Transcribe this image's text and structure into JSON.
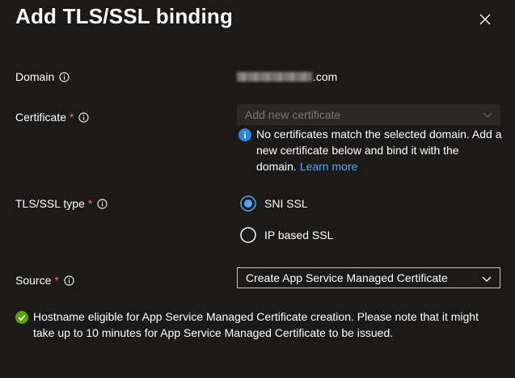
{
  "dialog": {
    "title": "Add TLS/SSL binding"
  },
  "domain": {
    "label": "Domain",
    "value_suffix": ".com"
  },
  "certificate": {
    "label": "Certificate",
    "required_mark": "*",
    "placeholder": "Add new certificate",
    "notice_text": "No certificates match the selected domain. Add a new certificate below and bind it with the domain.",
    "learn_more": "Learn more"
  },
  "tls_type": {
    "label": "TLS/SSL type",
    "required_mark": "*",
    "options": [
      {
        "label": "SNI SSL",
        "selected": true
      },
      {
        "label": "IP based SSL",
        "selected": false
      }
    ]
  },
  "source": {
    "label": "Source",
    "required_mark": "*",
    "selected": "Create App Service Managed Certificate"
  },
  "status": {
    "message": "Hostname eligible for App Service Managed Certificate creation. Please note that it might take up to 10 minutes for App Service Managed Certificate to be issued."
  },
  "colors": {
    "background": "#1b1a19",
    "accent": "#4fa6ff",
    "required": "#f1707b",
    "success": "#57a300",
    "info": "#2b88d8"
  }
}
